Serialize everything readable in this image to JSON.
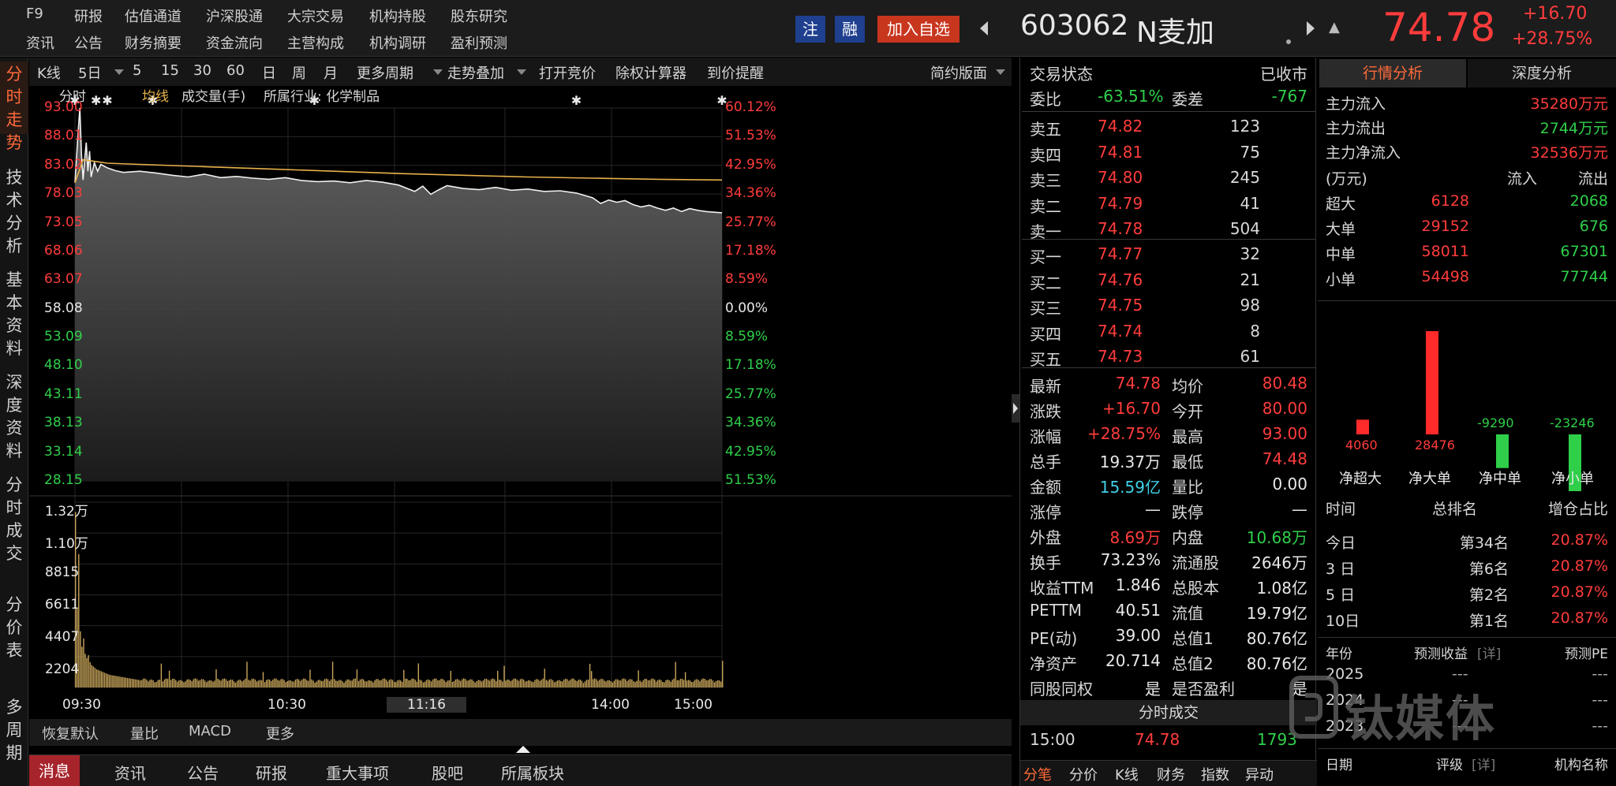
{
  "menu": {
    "row1": [
      "F9",
      "研报",
      "估值通道",
      "沪深股通",
      "大宗交易",
      "机构持股",
      "股东研究"
    ],
    "row2": [
      "资讯",
      "公告",
      "财务摘要",
      "资金流向",
      "主营构成",
      "机构调研",
      "盈利预测"
    ]
  },
  "header": {
    "tag_zhu": "注",
    "tag_rong": "融",
    "add_watch": "加入自选",
    "code": "603062",
    "name": "N麦加",
    "price": "74.78",
    "change": "+16.70",
    "change_pct": "+28.75%"
  },
  "left_tabs": [
    "分时走势",
    "技术分析",
    "基本资料",
    "深度资料",
    "分时成交",
    "分价表",
    "多周期"
  ],
  "toolbar": {
    "kline": "K线",
    "day5": "5日",
    "periods": [
      "5",
      "15",
      "30",
      "60",
      "日",
      "周",
      "月"
    ],
    "more_periods": "更多周期",
    "overlay": "走势叠加",
    "auction": "打开竞价",
    "calc": "除权计算器",
    "alert": "到价提醒",
    "layout": "简约版面"
  },
  "legend": {
    "fenshi": "分时",
    "junxian": "均线",
    "volume": "成交量(手)",
    "industry": "所属行业: 化学制品"
  },
  "chart_data": {
    "type": "line",
    "price_ticks": [
      "93.00",
      "88.01",
      "83.02",
      "78.03",
      "73.05",
      "68.06",
      "63.07",
      "58.08",
      "53.09",
      "48.10",
      "43.11",
      "38.13",
      "33.14",
      "28.15"
    ],
    "pct_ticks": [
      "60.12%",
      "51.53%",
      "42.95%",
      "34.36%",
      "25.77%",
      "17.18%",
      "8.59%",
      "0.00%",
      "8.59%",
      "17.18%",
      "25.77%",
      "34.36%",
      "42.95%",
      "51.53%"
    ],
    "volume_ticks": [
      "1.32万",
      "1.10万",
      "8815",
      "6611",
      "4407",
      "2204"
    ],
    "time_ticks": [
      "09:30",
      "10:30",
      "11:16",
      "14:00",
      "15:00"
    ],
    "prev_close": 58.08,
    "ylim": [
      28.15,
      93.0
    ],
    "price_series": [
      [
        0,
        80.0
      ],
      [
        1,
        84.5
      ],
      [
        2,
        89.0
      ],
      [
        3,
        93.0
      ],
      [
        4,
        85.0
      ],
      [
        5,
        80.5
      ],
      [
        6,
        84.0
      ],
      [
        7,
        87.0
      ],
      [
        8,
        82.0
      ],
      [
        9,
        85.5
      ],
      [
        10,
        81.0
      ],
      [
        12,
        83.5
      ],
      [
        14,
        82.0
      ],
      [
        16,
        83.2
      ],
      [
        20,
        82.6
      ],
      [
        25,
        82.1
      ],
      [
        30,
        81.8
      ],
      [
        40,
        82.0
      ],
      [
        50,
        81.7
      ],
      [
        60,
        81.3
      ],
      [
        70,
        81.0
      ],
      [
        80,
        81.5
      ],
      [
        90,
        80.9
      ],
      [
        100,
        81.1
      ],
      [
        110,
        80.8
      ],
      [
        120,
        80.6
      ],
      [
        130,
        80.9
      ],
      [
        140,
        80.4
      ],
      [
        150,
        80.2
      ],
      [
        160,
        80.3
      ],
      [
        170,
        80.0
      ],
      [
        180,
        80.4
      ],
      [
        190,
        80.1
      ],
      [
        200,
        79.6
      ],
      [
        210,
        78.5
      ],
      [
        215,
        79.4
      ],
      [
        220,
        78.0
      ],
      [
        225,
        78.8
      ],
      [
        230,
        79.5
      ],
      [
        240,
        79.0
      ],
      [
        250,
        78.8
      ],
      [
        260,
        79.2
      ],
      [
        270,
        78.7
      ],
      [
        280,
        78.9
      ],
      [
        290,
        78.5
      ],
      [
        300,
        78.6
      ],
      [
        310,
        78.2
      ],
      [
        320,
        77.4
      ],
      [
        325,
        76.4
      ],
      [
        330,
        77.0
      ],
      [
        335,
        76.6
      ],
      [
        340,
        76.9
      ],
      [
        345,
        76.2
      ],
      [
        350,
        75.8
      ],
      [
        355,
        76.1
      ],
      [
        360,
        75.6
      ],
      [
        365,
        75.2
      ],
      [
        370,
        75.6
      ],
      [
        375,
        75.0
      ],
      [
        380,
        75.5
      ],
      [
        385,
        75.2
      ],
      [
        390,
        75.0
      ],
      [
        400,
        74.78
      ]
    ],
    "avg_series": [
      [
        0,
        80.0
      ],
      [
        5,
        84.0
      ],
      [
        10,
        83.8
      ],
      [
        20,
        83.4
      ],
      [
        40,
        83.2
      ],
      [
        80,
        82.8
      ],
      [
        120,
        82.4
      ],
      [
        160,
        82.0
      ],
      [
        200,
        81.6
      ],
      [
        240,
        81.3
      ],
      [
        280,
        81.0
      ],
      [
        320,
        80.8
      ],
      [
        360,
        80.6
      ],
      [
        400,
        80.48
      ]
    ],
    "vol_max": 13200,
    "volume": [
      12500,
      5600,
      9500,
      4000,
      2900,
      3500,
      2400,
      2100,
      2300,
      1800,
      1600,
      1500,
      1400,
      1300,
      1250,
      1200,
      1150,
      1100,
      1050,
      1000,
      950,
      900,
      880,
      860,
      840,
      820,
      800,
      780,
      760,
      740,
      720,
      700,
      680,
      660,
      640,
      620,
      600,
      580,
      560,
      540
    ],
    "markers_min": [
      0,
      13,
      20,
      48,
      148,
      310,
      400
    ]
  },
  "sub_tabs": [
    "恢复默认",
    "量比",
    "MACD",
    "更多"
  ],
  "bottom_tabs": [
    "消息",
    "资讯",
    "公告",
    "研报",
    "重大事项",
    "股吧",
    "所属板块"
  ],
  "book": {
    "status_label": "交易状态",
    "status_value": "已收市",
    "weibi_label": "委比",
    "weibi_value": "-63.51%",
    "weicha_label": "委差",
    "weicha_value": "-767",
    "asks": [
      {
        "label": "卖五",
        "price": "74.82",
        "vol": "123"
      },
      {
        "label": "卖四",
        "price": "74.81",
        "vol": "75"
      },
      {
        "label": "卖三",
        "price": "74.80",
        "vol": "245"
      },
      {
        "label": "卖二",
        "price": "74.79",
        "vol": "41"
      },
      {
        "label": "卖一",
        "price": "74.78",
        "vol": "504"
      }
    ],
    "bids": [
      {
        "label": "买一",
        "price": "74.77",
        "vol": "32"
      },
      {
        "label": "买二",
        "price": "74.76",
        "vol": "21"
      },
      {
        "label": "买三",
        "price": "74.75",
        "vol": "98"
      },
      {
        "label": "买四",
        "price": "74.74",
        "vol": "8"
      },
      {
        "label": "买五",
        "price": "74.73",
        "vol": "61"
      }
    ],
    "stats": [
      {
        "l1": "最新",
        "v1": "74.78",
        "c1": "red",
        "l2": "均价",
        "v2": "80.48",
        "c2": "red"
      },
      {
        "l1": "涨跌",
        "v1": "+16.70",
        "c1": "red",
        "l2": "今开",
        "v2": "80.00",
        "c2": "red"
      },
      {
        "l1": "涨幅",
        "v1": "+28.75%",
        "c1": "red",
        "l2": "最高",
        "v2": "93.00",
        "c2": "red"
      },
      {
        "l1": "总手",
        "v1": "19.37万",
        "c1": "white",
        "l2": "最低",
        "v2": "74.48",
        "c2": "red"
      },
      {
        "l1": "金额",
        "v1": "15.59亿",
        "c1": "cyan",
        "l2": "量比",
        "v2": "0.00",
        "c2": "white"
      },
      {
        "l1": "涨停",
        "v1": "—",
        "c1": "white",
        "l2": "跌停",
        "v2": "—",
        "c2": "white"
      },
      {
        "l1": "外盘",
        "v1": "8.69万",
        "c1": "red",
        "l2": "内盘",
        "v2": "10.68万",
        "c2": "green"
      },
      {
        "l1": "换手",
        "v1": "73.23%",
        "c1": "white",
        "l2": "流通股",
        "v2": "2646万",
        "c2": "white"
      },
      {
        "l1": "收益TTM",
        "v1": "1.846",
        "c1": "white",
        "l2": "总股本",
        "v2": "1.08亿",
        "c2": "white"
      },
      {
        "l1": "PETTM",
        "v1": "40.51",
        "c1": "white",
        "l2": "流值",
        "v2": "19.79亿",
        "c2": "white"
      },
      {
        "l1": "PE(动)",
        "v1": "39.00",
        "c1": "white",
        "l2": "总值1",
        "v2": "80.76亿",
        "c2": "white"
      },
      {
        "l1": "净资产",
        "v1": "20.714",
        "c1": "white",
        "l2": "总值2",
        "v2": "80.76亿",
        "c2": "white"
      },
      {
        "l1": "同股同权",
        "v1": "是",
        "c1": "white",
        "l2": "是否盈利",
        "v2": "是",
        "c2": "white"
      }
    ],
    "trades_title": "分时成交",
    "trade": {
      "time": "15:00",
      "price": "74.78",
      "vol": "1793"
    },
    "tabs": [
      "分笔",
      "分价",
      "K线",
      "财务",
      "指数",
      "异动"
    ]
  },
  "analysis": {
    "tab1": "行情分析",
    "tab2": "深度分析",
    "flows": [
      {
        "label": "主力流入",
        "value": "35280万元",
        "color": "red"
      },
      {
        "label": "主力流出",
        "value": "2744万元",
        "color": "green"
      },
      {
        "label": "主力净流入",
        "value": "32536万元",
        "color": "red"
      }
    ],
    "table_head": {
      "unit": "(万元)",
      "in": "流入",
      "out": "流出"
    },
    "table": [
      {
        "label": "超大",
        "in": "6128",
        "out": "2068"
      },
      {
        "label": "大单",
        "in": "29152",
        "out": "676"
      },
      {
        "label": "中单",
        "in": "58011",
        "out": "67301"
      },
      {
        "label": "小单",
        "in": "54498",
        "out": "77744"
      }
    ],
    "net_bars": [
      {
        "label": "净超大",
        "value": 4060,
        "text": "4060"
      },
      {
        "label": "净大单",
        "value": 28476,
        "text": "28476"
      },
      {
        "label": "净中单",
        "value": -9290,
        "text": "-9290"
      },
      {
        "label": "净小单",
        "value": -23246,
        "text": "-23246"
      }
    ],
    "rank_head": {
      "time": "时间",
      "rank": "总排名",
      "pct": "增仓占比"
    },
    "ranks": [
      {
        "time": "今日",
        "rank": "第34名",
        "pct": "20.87%"
      },
      {
        "time": "3 日",
        "rank": "第6名",
        "pct": "20.87%"
      },
      {
        "time": "5 日",
        "rank": "第2名",
        "pct": "20.87%"
      },
      {
        "time": "10日",
        "rank": "第1名",
        "pct": "20.87%"
      }
    ],
    "forecast_head": {
      "year": "年份",
      "eps": "预测收益",
      "detail": "[详]",
      "pe": "预测PE"
    },
    "forecast": [
      {
        "year": "2025",
        "eps": "---",
        "pe": "---"
      },
      {
        "year": "2024",
        "eps": "---",
        "pe": "---"
      },
      {
        "year": "2023",
        "eps": "---",
        "pe": "---"
      }
    ],
    "rating_head": {
      "date": "日期",
      "rating": "评级",
      "detail": "[详]",
      "org": "机构名称"
    },
    "watermark": "钛媒体"
  },
  "colors": {
    "red": "#ff3c3c",
    "green": "#2fcf4a",
    "gold": "#e8b24a",
    "tag_blue": "#1f3f8f",
    "tag_red": "#c8361e"
  }
}
